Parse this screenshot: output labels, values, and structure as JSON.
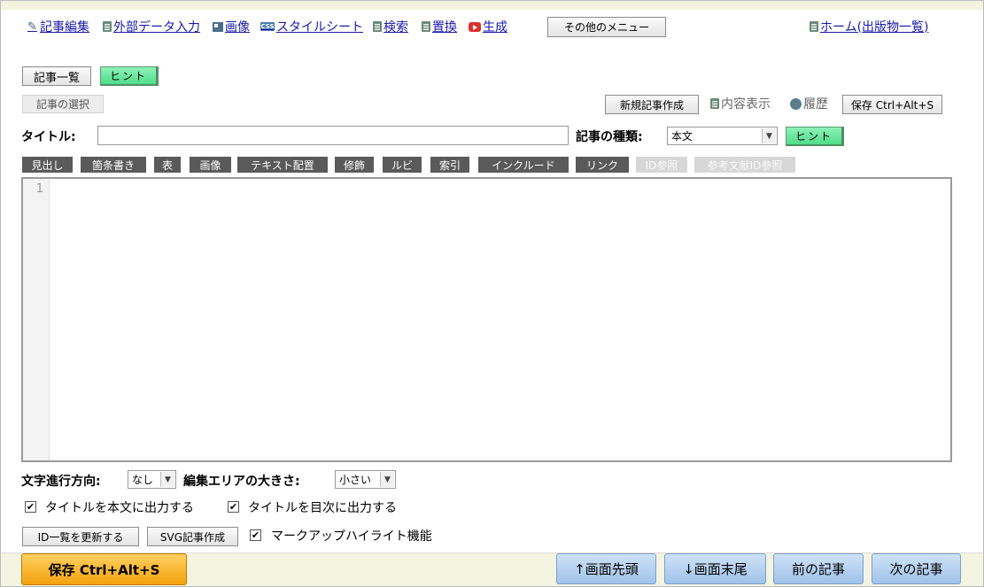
{
  "nav": {
    "edit_article": "記事編集",
    "external_data": "外部データ入力",
    "image": "画像",
    "stylesheet": "スタイルシート",
    "search": "検索",
    "replace": "置換",
    "generate": "生成",
    "other_menu": "その他のメニュー",
    "home": "ホーム(出版物一覧)",
    "css_badge": "CSS"
  },
  "article_list_button": "記事一覧",
  "hint_button": "ヒント",
  "select_article_button": "記事の選択",
  "new_article_button": "新規記事作成",
  "content_view": "内容表示",
  "history": "履歴",
  "save_button": "保存 Ctrl+Alt+S",
  "title_label": "タイトル:",
  "title_value": "",
  "article_type_label": "記事の種類:",
  "article_type_value": "本文",
  "toolbar": {
    "buttons": [
      "見出し",
      "箇条書き",
      "表",
      "画像",
      "テキスト配置",
      "修飾",
      "ルビ",
      "索引",
      "インクルード",
      "リンク",
      "ID参照",
      "参考文献ID参照"
    ]
  },
  "editor": {
    "line_number": "1"
  },
  "text_direction_label": "文字進行方向:",
  "text_direction_value": "なし",
  "edit_area_size_label": "編集エリアの大きさ:",
  "edit_area_size_value": "小さい",
  "options": {
    "title_to_body": "タイトルを本文に出力する",
    "title_to_toc": "タイトルを目次に出力する",
    "markup_highlight": "マークアップハイライト機能"
  },
  "id_list_button": "ID一覧を更新する",
  "svg_article_button": "SVG記事作成",
  "footer": {
    "save": "保存 Ctrl+Alt+S",
    "page_top": "↑画面先頭",
    "page_bottom": "↓画面末尾",
    "prev_article": "前の記事",
    "next_article": "次の記事"
  },
  "colors": {
    "hint_green": "#4fdd8a",
    "save_orange": "#f3a20f",
    "nav_blue": "#9fc2ea",
    "toolbar_dark": "#5a5a5a"
  }
}
